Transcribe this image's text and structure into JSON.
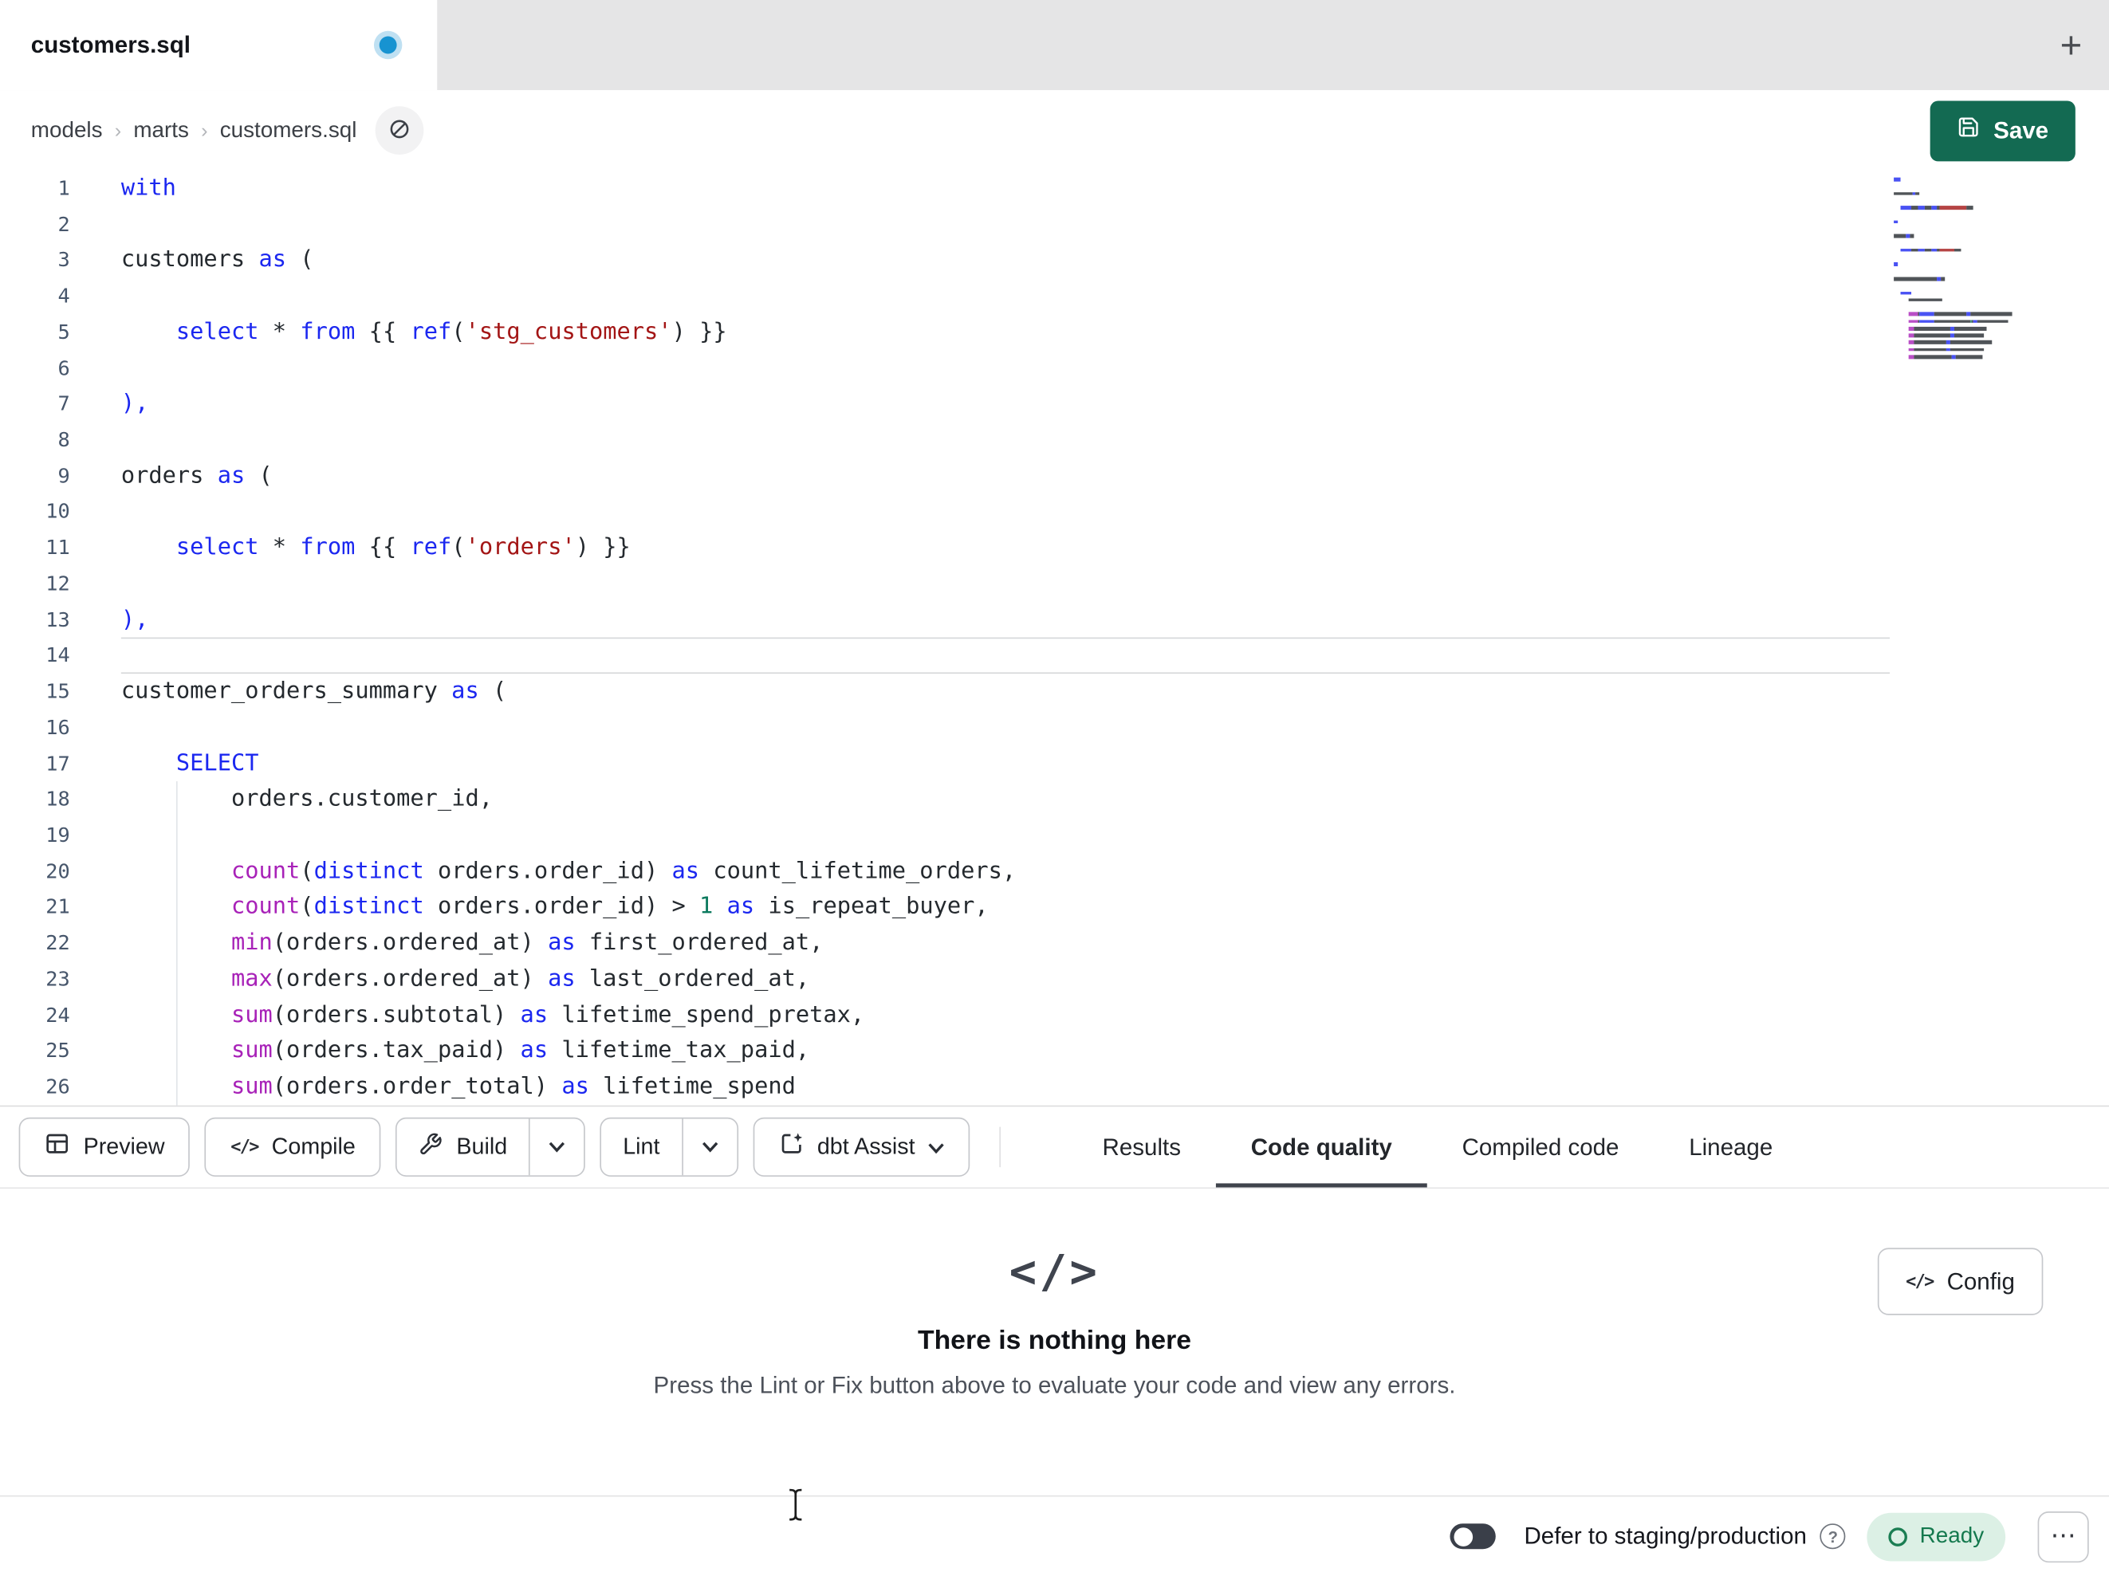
{
  "colors": {
    "save_button_bg": "#136a52",
    "ready_bg": "#dcf0e5",
    "ready_text": "#15794e",
    "unsaved_dot": "#1793d1"
  },
  "icons": {
    "code_glyph": "</>"
  },
  "tab_bar": {
    "active_tab": "customers.sql",
    "new_tab_label": "+"
  },
  "breadcrumb": {
    "items": [
      "models",
      "marts",
      "customers.sql"
    ],
    "separator": "›"
  },
  "header": {
    "save_label": "Save"
  },
  "editor": {
    "current_line": 14,
    "token_colors": {
      "kw": "#1b27f0",
      "fn": "#a822b8",
      "str": "#a31515",
      "num": "#0c7a5e",
      "id": "#24292e",
      "br": "#1b27f0"
    },
    "lines": [
      {
        "n": 1,
        "tokens": [
          [
            "kw",
            "with"
          ]
        ]
      },
      {
        "n": 2,
        "tokens": []
      },
      {
        "n": 3,
        "tokens": [
          [
            "id",
            "customers "
          ],
          [
            "kw",
            "as"
          ],
          [
            "id",
            " ("
          ]
        ]
      },
      {
        "n": 4,
        "tokens": []
      },
      {
        "n": 5,
        "tokens": [
          [
            "ws",
            "    "
          ],
          [
            "kw",
            "select"
          ],
          [
            "id",
            " * "
          ],
          [
            "kw",
            "from"
          ],
          [
            "id",
            " {{ "
          ],
          [
            "kw",
            "ref"
          ],
          [
            "id",
            "("
          ],
          [
            "str",
            "'stg_customers'"
          ],
          [
            "id",
            ") }}"
          ]
        ]
      },
      {
        "n": 6,
        "tokens": []
      },
      {
        "n": 7,
        "tokens": [
          [
            "br",
            "),"
          ]
        ]
      },
      {
        "n": 8,
        "tokens": []
      },
      {
        "n": 9,
        "tokens": [
          [
            "id",
            "orders "
          ],
          [
            "kw",
            "as"
          ],
          [
            "id",
            " ("
          ]
        ]
      },
      {
        "n": 10,
        "tokens": []
      },
      {
        "n": 11,
        "tokens": [
          [
            "ws",
            "    "
          ],
          [
            "kw",
            "select"
          ],
          [
            "id",
            " * "
          ],
          [
            "kw",
            "from"
          ],
          [
            "id",
            " {{ "
          ],
          [
            "kw",
            "ref"
          ],
          [
            "id",
            "("
          ],
          [
            "str",
            "'orders'"
          ],
          [
            "id",
            ") }}"
          ]
        ]
      },
      {
        "n": 12,
        "tokens": []
      },
      {
        "n": 13,
        "tokens": [
          [
            "br",
            "),"
          ]
        ]
      },
      {
        "n": 14,
        "tokens": []
      },
      {
        "n": 15,
        "tokens": [
          [
            "id",
            "customer_orders_summary "
          ],
          [
            "kw",
            "as"
          ],
          [
            "id",
            " ("
          ]
        ]
      },
      {
        "n": 16,
        "tokens": []
      },
      {
        "n": 17,
        "tokens": [
          [
            "ws",
            "    "
          ],
          [
            "kw",
            "SELECT"
          ]
        ]
      },
      {
        "n": 18,
        "tokens": [
          [
            "ws",
            "        "
          ],
          [
            "id",
            "orders.customer_id,"
          ]
        ]
      },
      {
        "n": 19,
        "tokens": []
      },
      {
        "n": 20,
        "tokens": [
          [
            "ws",
            "        "
          ],
          [
            "fn",
            "count"
          ],
          [
            "id",
            "("
          ],
          [
            "kw",
            "distinct"
          ],
          [
            "id",
            " orders.order_id) "
          ],
          [
            "kw",
            "as"
          ],
          [
            "id",
            " count_lifetime_orders,"
          ]
        ]
      },
      {
        "n": 21,
        "tokens": [
          [
            "ws",
            "        "
          ],
          [
            "fn",
            "count"
          ],
          [
            "id",
            "("
          ],
          [
            "kw",
            "distinct"
          ],
          [
            "id",
            " orders.order_id) > "
          ],
          [
            "num",
            "1"
          ],
          [
            "id",
            " "
          ],
          [
            "kw",
            "as"
          ],
          [
            "id",
            " is_repeat_buyer,"
          ]
        ]
      },
      {
        "n": 22,
        "tokens": [
          [
            "ws",
            "        "
          ],
          [
            "fn",
            "min"
          ],
          [
            "id",
            "(orders.ordered_at) "
          ],
          [
            "kw",
            "as"
          ],
          [
            "id",
            " first_ordered_at,"
          ]
        ]
      },
      {
        "n": 23,
        "tokens": [
          [
            "ws",
            "        "
          ],
          [
            "fn",
            "max"
          ],
          [
            "id",
            "(orders.ordered_at) "
          ],
          [
            "kw",
            "as"
          ],
          [
            "id",
            " last_ordered_at,"
          ]
        ]
      },
      {
        "n": 24,
        "tokens": [
          [
            "ws",
            "        "
          ],
          [
            "fn",
            "sum"
          ],
          [
            "id",
            "(orders.subtotal) "
          ],
          [
            "kw",
            "as"
          ],
          [
            "id",
            " lifetime_spend_pretax,"
          ]
        ]
      },
      {
        "n": 25,
        "tokens": [
          [
            "ws",
            "        "
          ],
          [
            "fn",
            "sum"
          ],
          [
            "id",
            "(orders.tax_paid) "
          ],
          [
            "kw",
            "as"
          ],
          [
            "id",
            " lifetime_tax_paid,"
          ]
        ]
      },
      {
        "n": 26,
        "tokens": [
          [
            "ws",
            "        "
          ],
          [
            "fn",
            "sum"
          ],
          [
            "id",
            "(orders.order_total) "
          ],
          [
            "kw",
            "as"
          ],
          [
            "id",
            " lifetime_spend"
          ]
        ]
      }
    ]
  },
  "toolbar": {
    "preview_label": "Preview",
    "compile_label": "Compile",
    "build_label": "Build",
    "lint_label": "Lint",
    "assist_label": "dbt Assist"
  },
  "result_tabs": [
    {
      "label": "Results",
      "active": false
    },
    {
      "label": "Code quality",
      "active": true
    },
    {
      "label": "Compiled code",
      "active": false
    },
    {
      "label": "Lineage",
      "active": false
    }
  ],
  "empty_state": {
    "icon": "</>",
    "title": "There is nothing here",
    "subtitle": "Press the Lint or Fix button above to evaluate your code and view any errors.",
    "config_label": "Config"
  },
  "status_bar": {
    "defer_label": "Defer to staging/production",
    "help_glyph": "?",
    "ready_label": "Ready",
    "overflow_glyph": "⋯"
  }
}
